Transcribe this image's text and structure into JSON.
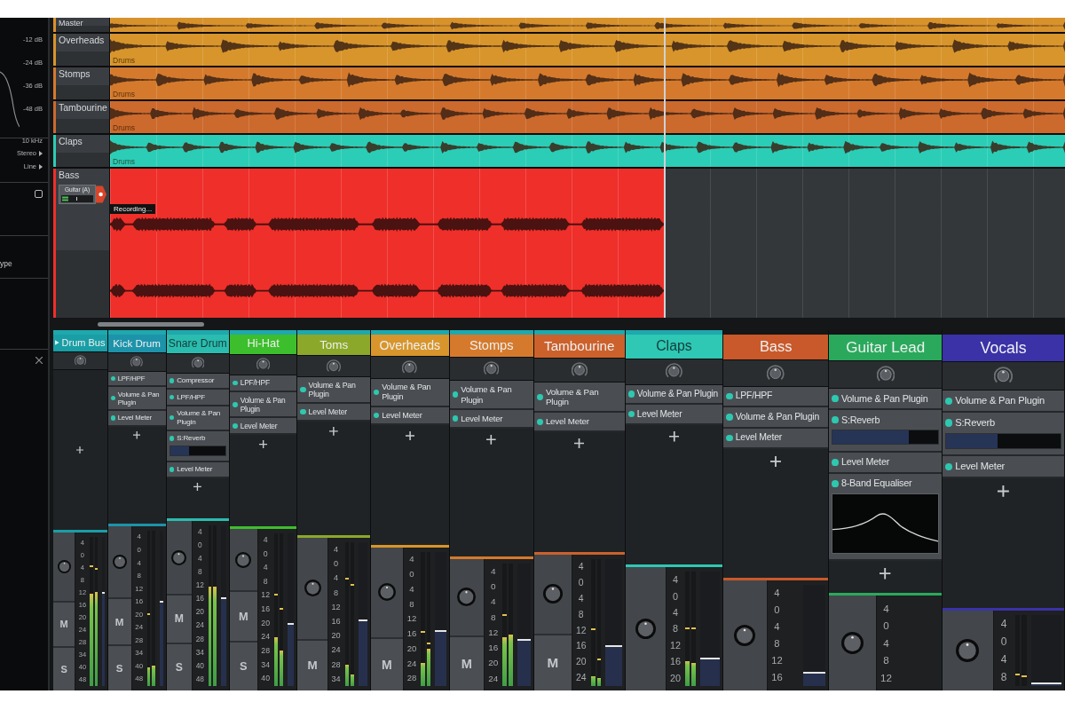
{
  "inspector": {
    "eq": {
      "db_labels": [
        "-12 dB",
        "-24 dB",
        "-36 dB",
        "-48 dB"
      ],
      "frequency": "10 kHz"
    },
    "routing": [
      "Stereo",
      "Line"
    ],
    "option": {
      "checked": false
    },
    "field_label": "ype"
  },
  "tracks": [
    {
      "name": "Master",
      "kind": "master",
      "color": "#d8922c"
    },
    {
      "name": "Overheads",
      "kind": "audio",
      "color": "#d8952b",
      "clip_label": "Drums"
    },
    {
      "name": "Stomps",
      "kind": "audio",
      "color": "#d57a2c",
      "clip_label": "Drums"
    },
    {
      "name": "Tambourine",
      "kind": "audio",
      "color": "#cc692c",
      "clip_label": "Drums"
    },
    {
      "name": "Claps",
      "kind": "audio",
      "color": "#2bcdb6",
      "clip_label": "Drums"
    },
    {
      "name": "Bass",
      "kind": "recording",
      "color": "#ef2f2a",
      "input": "Guitar (A)",
      "status": "Recording..."
    }
  ],
  "mixer": {
    "group": {
      "color": "#1fa8ad"
    },
    "channels": [
      {
        "name": "Drum Bus",
        "kind": "bus",
        "color": "#1a9ea6",
        "grouped": true,
        "scale": [
          "4",
          "0",
          "4",
          "8",
          "12",
          "16",
          "20",
          "24",
          "28",
          "34",
          "40",
          "48"
        ],
        "buttons": [
          "M",
          "S"
        ],
        "meters": [
          {
            "level": 0.62,
            "hold": {
              "level": 0.8
            }
          },
          {
            "level": 0.63,
            "hold": {
              "level": 0.78
            }
          }
        ],
        "fader": {
          "level": 0.63
        }
      },
      {
        "name": "Kick Drum",
        "kind": "track",
        "color": "#1d93aa",
        "grouped": true,
        "plugins": [
          {
            "name": "LPF/HPF",
            "kind": "plain",
            "enabled": true
          },
          {
            "name": "Volume & Pan Plugin",
            "kind": "plain",
            "enabled": true
          },
          {
            "name": "Level Meter",
            "kind": "plain",
            "enabled": true
          }
        ],
        "scale": [
          "4",
          "0",
          "4",
          "8",
          "12",
          "16",
          "20",
          "24",
          "28",
          "34",
          "40",
          "48"
        ],
        "buttons": [
          "M",
          "S"
        ],
        "meters": [
          {
            "level": 0.12,
            "hold": {
              "level": 0.46
            }
          },
          {
            "level": 0.13
          }
        ],
        "fader": {
          "level": 0.55
        }
      },
      {
        "name": "Snare Drum",
        "kind": "track",
        "color": "#2abcae",
        "grouped": true,
        "plugins": [
          {
            "name": "Compressor",
            "kind": "plain",
            "enabled": true
          },
          {
            "name": "LPF/HPF",
            "kind": "plain",
            "enabled": true
          },
          {
            "name": "Volume & Pan Plugin",
            "kind": "plain",
            "enabled": true
          },
          {
            "name": "S:Reverb",
            "kind": "slider",
            "enabled": true,
            "level": 0.35
          },
          {
            "name": "Level Meter",
            "kind": "plain",
            "enabled": true
          }
        ],
        "scale": [
          "4",
          "0",
          "4",
          "8",
          "12",
          "16",
          "20",
          "24",
          "28",
          "34",
          "40",
          "48"
        ],
        "buttons": [
          "M",
          "S"
        ],
        "meters": [
          {
            "level": 0.62
          },
          {
            "level": 0.62
          }
        ],
        "fader": {
          "level": 0.55
        }
      },
      {
        "name": "Hi-Hat",
        "kind": "track",
        "color": "#3dbe2c",
        "grouped": true,
        "plugins": [
          {
            "name": "LPF/HPF",
            "kind": "plain",
            "enabled": true
          },
          {
            "name": "Volume & Pan Plugin",
            "kind": "plain",
            "enabled": true
          },
          {
            "name": "Level Meter",
            "kind": "plain",
            "enabled": true
          }
        ],
        "scale": [
          "4",
          "0",
          "4",
          "8",
          "12",
          "16",
          "20",
          "24",
          "28",
          "34",
          "40"
        ],
        "buttons": [
          "M",
          "S"
        ],
        "meters": [
          {
            "level": 0.32,
            "hold": {
              "level": 0.59
            }
          },
          {
            "level": 0.23,
            "hold": {
              "level": 0.5
            }
          }
        ],
        "fader": {
          "level": 0.41
        }
      },
      {
        "name": "Toms",
        "kind": "track",
        "color": "#8ca82a",
        "grouped": true,
        "plugins": [
          {
            "name": "Volume & Pan Plugin",
            "kind": "plain",
            "enabled": true
          },
          {
            "name": "Level Meter",
            "kind": "plain",
            "enabled": true
          }
        ],
        "scale": [
          "4",
          "0",
          "4",
          "8",
          "12",
          "16",
          "20",
          "24",
          "28",
          "34"
        ],
        "buttons": [
          "M"
        ],
        "meters": [
          {
            "level": 0.15,
            "hold": {
              "level": 0.74
            }
          },
          {
            "level": 0.08,
            "hold": {
              "level": 0.7
            }
          }
        ],
        "fader": {
          "level": 0.46
        }
      },
      {
        "name": "Overheads",
        "kind": "track",
        "color": "#d8952b",
        "grouped": true,
        "plugins": [
          {
            "name": "Volume & Pan Plugin",
            "kind": "plain",
            "enabled": true
          },
          {
            "name": "Level Meter",
            "kind": "plain",
            "enabled": true
          }
        ],
        "scale": [
          "4",
          "0",
          "4",
          "8",
          "12",
          "16",
          "20",
          "24",
          "28"
        ],
        "buttons": [
          "M"
        ],
        "meters": [
          {
            "level": 0.17,
            "hold": {
              "level": 0.4
            }
          },
          {
            "level": 0.28,
            "hold": {
              "level": 0.31
            }
          }
        ],
        "fader": {
          "level": 0.42
        }
      },
      {
        "name": "Stomps",
        "kind": "track",
        "color": "#d57a2c",
        "grouped": true,
        "plugins": [
          {
            "name": "Volume & Pan Plugin",
            "kind": "plain",
            "enabled": true
          },
          {
            "name": "Level Meter",
            "kind": "plain",
            "enabled": true
          }
        ],
        "scale": [
          "4",
          "0",
          "4",
          "8",
          "12",
          "16",
          "20",
          "24"
        ],
        "buttons": [
          "M"
        ],
        "meters": [
          {
            "level": 0.4,
            "hold": {
              "level": 0.57
            }
          },
          {
            "level": 0.42
          }
        ],
        "fader": {
          "level": 0.38
        }
      },
      {
        "name": "Tambourine",
        "kind": "track",
        "color": "#cc612c",
        "grouped": true,
        "plugins": [
          {
            "name": "Volume & Pan Plugin",
            "kind": "plain",
            "enabled": true
          },
          {
            "name": "Level Meter",
            "kind": "plain",
            "enabled": true
          }
        ],
        "scale": [
          "4",
          "0",
          "4",
          "8",
          "12",
          "16",
          "20",
          "24"
        ],
        "buttons": [
          "M"
        ],
        "meters": [
          {
            "level": 0.08,
            "hold": {
              "level": 0.44
            }
          },
          {
            "level": 0.06,
            "hold": {
              "level": 0.2
            }
          }
        ],
        "fader": {
          "level": 0.32
        }
      },
      {
        "name": "Claps",
        "kind": "track",
        "color": "#2ec8b4",
        "grouped": true,
        "plugins": [
          {
            "name": "Volume & Pan Plugin",
            "kind": "plain",
            "enabled": true
          },
          {
            "name": "Level Meter",
            "kind": "plain",
            "enabled": true
          }
        ],
        "scale": [
          "4",
          "0",
          "4",
          "8",
          "12",
          "16",
          "20"
        ],
        "meters": [
          {
            "level": 0.22,
            "hold": {
              "level": 0.5
            }
          },
          {
            "level": 0.2,
            "hold": {
              "level": 0.5
            }
          }
        ],
        "fader": {
          "level": 0.25
        }
      },
      {
        "name": "Bass",
        "kind": "track",
        "color": "#c9592a",
        "grouped": false,
        "plugins": [
          {
            "name": "LPF/HPF",
            "kind": "plain",
            "enabled": true
          },
          {
            "name": "Volume & Pan Plugin",
            "kind": "plain",
            "enabled": true
          },
          {
            "name": "Level Meter",
            "kind": "plain",
            "enabled": true
          }
        ],
        "scale": [
          "4",
          "0",
          "4",
          "8",
          "12",
          "16"
        ],
        "fader": {
          "level": 0.14
        }
      },
      {
        "name": "Guitar Lead",
        "kind": "track",
        "color": "#2aa95c",
        "grouped": false,
        "plugins": [
          {
            "name": "Volume & Pan Plugin",
            "kind": "plain",
            "enabled": true
          },
          {
            "name": "S:Reverb",
            "kind": "slider",
            "enabled": true,
            "level": 0.72
          },
          {
            "name": "Level Meter",
            "kind": "plain",
            "enabled": true
          },
          {
            "name": "8-Band Equaliser",
            "kind": "graph",
            "enabled": true
          }
        ],
        "scale": [
          "4",
          "0",
          "4",
          "8",
          "12"
        ]
      },
      {
        "name": "Vocals",
        "kind": "track",
        "color": "#3b32a8",
        "grouped": false,
        "plugins": [
          {
            "name": "Volume & Pan Plugin",
            "kind": "plain",
            "enabled": true
          },
          {
            "name": "S:Reverb",
            "kind": "slider",
            "enabled": true,
            "level": 0.45
          },
          {
            "name": "Level Meter",
            "kind": "plain",
            "enabled": true
          }
        ],
        "scale": [
          "4",
          "0",
          "4",
          "8"
        ],
        "meters": [
          {
            "hold": {
              "level": 0.15
            }
          },
          {
            "hold": {
              "level": 0.12
            }
          }
        ],
        "fader": {
          "level": 0.05
        }
      }
    ]
  }
}
